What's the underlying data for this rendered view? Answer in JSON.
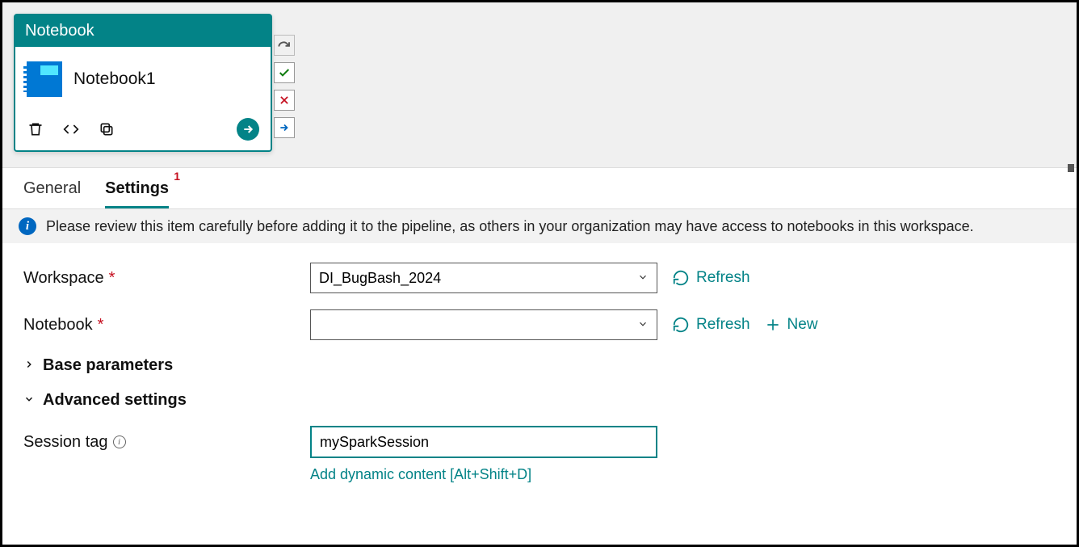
{
  "activity": {
    "type_label": "Notebook",
    "name": "Notebook1"
  },
  "tabs": {
    "general": "General",
    "settings": "Settings",
    "settings_badge": "1"
  },
  "banner": {
    "message": "Please review this item carefully before adding it to the pipeline, as others in your organization may have access to notebooks in this workspace."
  },
  "form": {
    "workspace_label": "Workspace",
    "workspace_value": "DI_BugBash_2024",
    "notebook_label": "Notebook",
    "notebook_value": "",
    "refresh_label": "Refresh",
    "new_label": "New",
    "base_parameters_label": "Base parameters",
    "advanced_settings_label": "Advanced settings",
    "session_tag_label": "Session tag",
    "session_tag_value": "mySparkSession",
    "dynamic_content_label": "Add dynamic content [Alt+Shift+D]"
  },
  "colors": {
    "primary": "#038387",
    "error": "#C50F1F",
    "info": "#0067C0"
  }
}
